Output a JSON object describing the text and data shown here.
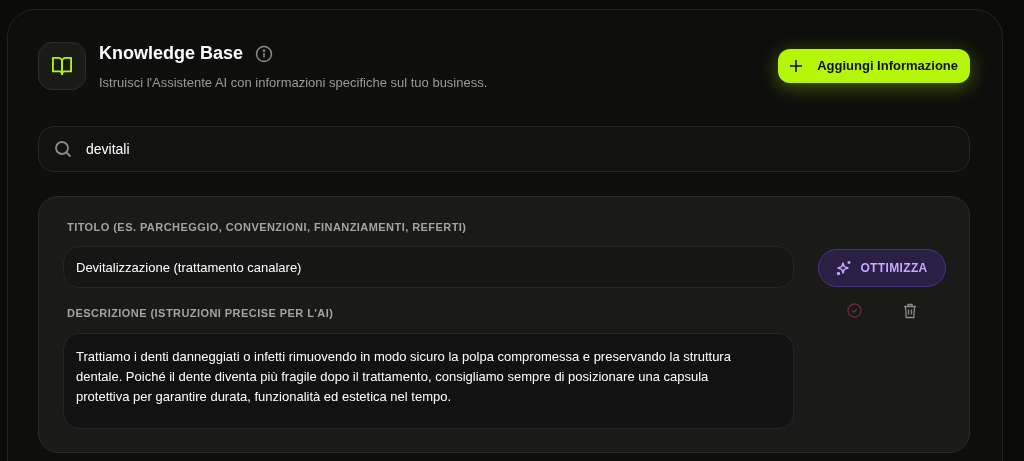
{
  "header": {
    "title": "Knowledge Base",
    "subtitle": "Istruisci l'Assistente AI con informazioni specifiche sul tuo business.",
    "add_button": "Aggiungi Informazione"
  },
  "search": {
    "value": "devitali"
  },
  "entries": [
    {
      "title_label": "TITOLO (ES. PARCHEGGIO, CONVENZIONI, FINANZIAMENTI, REFERTI)",
      "title": "Devitalizzazione (trattamento canalare)",
      "optimize_button": "OTTIMIZZA",
      "description_label": "DESCRIZIONE (ISTRUZIONI PRECISE PER L'AI)",
      "description": "Trattiamo i denti danneggiati o infetti rimuovendo in modo sicuro la polpa compromessa e preservando la struttura dentale. Poiché il dente diventa più fragile dopo il trattamento, consigliamo sempre di posizionare una capsula protettiva per garantire durata, funzionalità ed estetica nel tempo."
    }
  ]
}
